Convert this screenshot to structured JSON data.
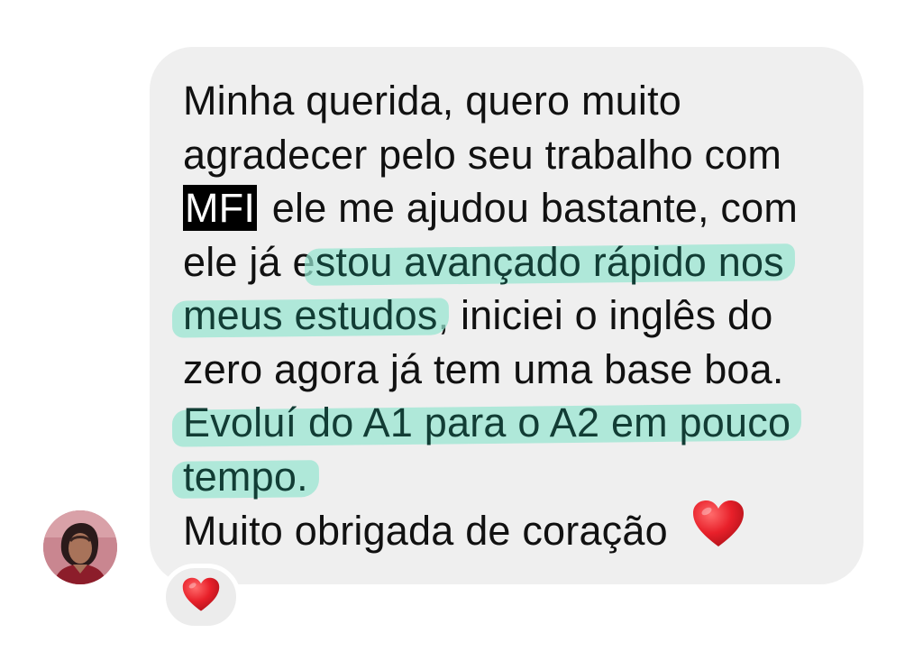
{
  "message": {
    "line1": "Minha querida, quero muito",
    "line2": "agradecer pelo seu trabalho com",
    "line3_redacted": "MFI",
    "line3_rest": " ele me ajudou bastante, com",
    "line4_plain": "ele já e",
    "line4_highlight": "stou avançado rápido nos",
    "line5_highlight": "meus estudos",
    "line5_rest": ", iniciei o inglês do",
    "line6": "zero agora já tem uma base boa.",
    "line7_highlight": "Evoluí do A1 para o A2 em pouco",
    "line8_highlight": "tempo.",
    "line9": "Muito obrigada de coração",
    "line9_emoji": "heart-emoji"
  },
  "colors": {
    "bubble": "#efefef",
    "highlight": "#96e4d0",
    "highlight_text": "#123d35",
    "text": "#111111",
    "heart": "#e8202a"
  },
  "reaction": {
    "emoji": "heart-emoji"
  },
  "avatar": {
    "icon": "user-avatar"
  }
}
